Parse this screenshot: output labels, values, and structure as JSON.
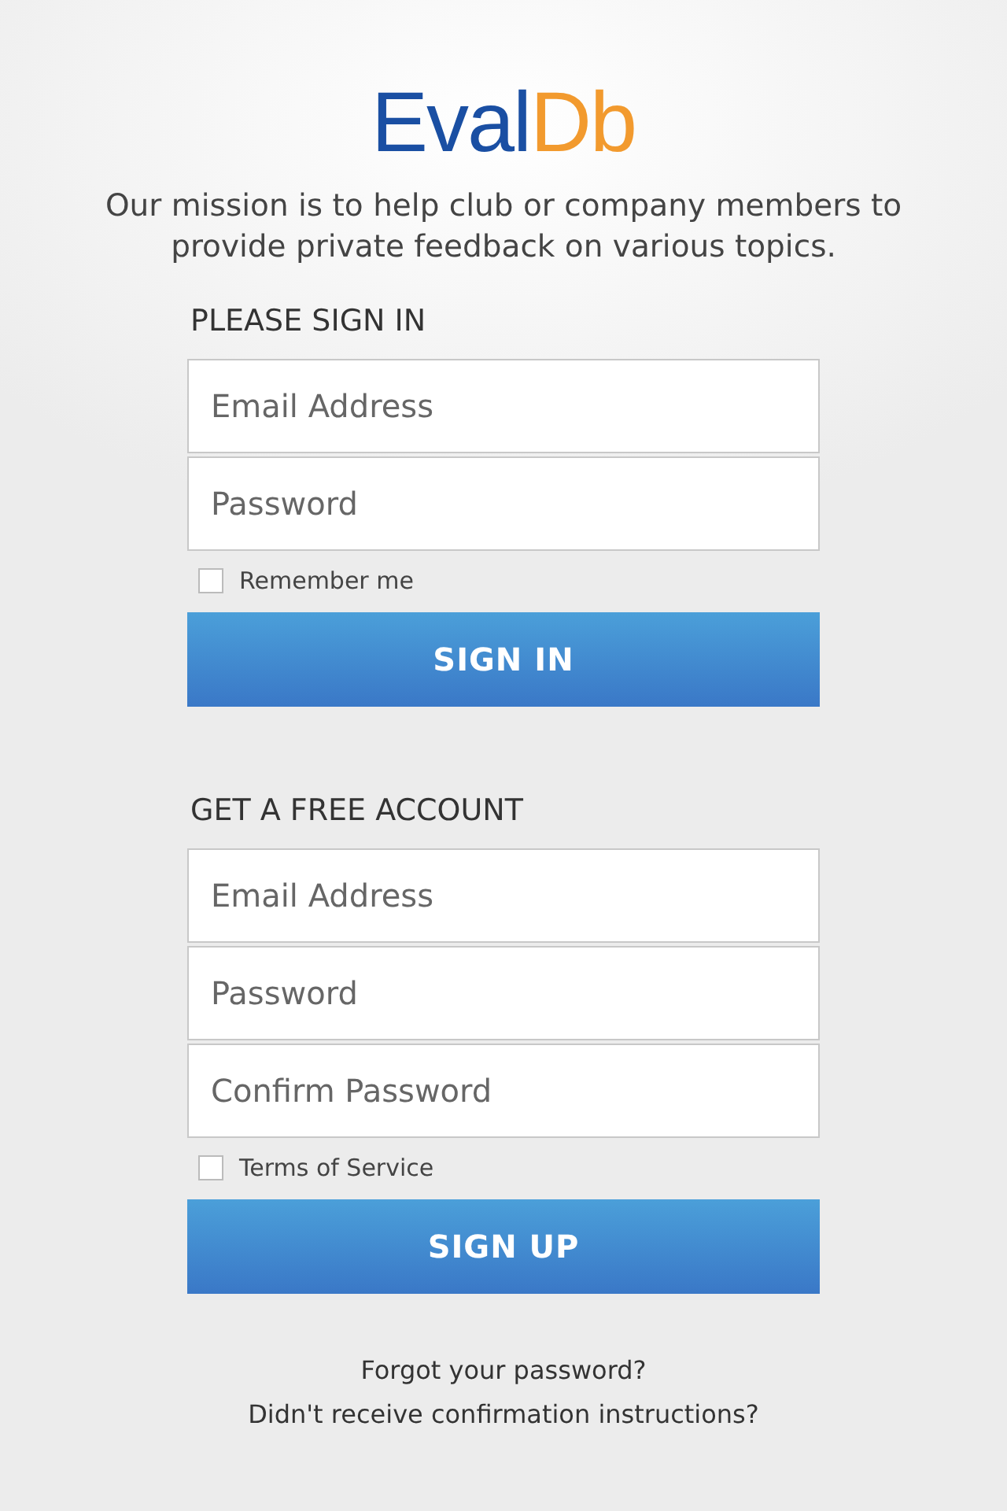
{
  "logo": {
    "parts": [
      {
        "text": "Eval",
        "color": "#1a4fa3"
      },
      {
        "text": "Db",
        "color": "#f29a2e"
      }
    ]
  },
  "mission": "Our mission is to help club or company members to provide private feedback on various topics.",
  "sections": [
    {
      "heading": "PLEASE SIGN IN",
      "fields": [
        {
          "placeholder": "Email Address"
        },
        {
          "placeholder": "Password"
        }
      ],
      "checkbox": {
        "label": "Remember me",
        "checked": false
      },
      "button": "SIGN IN"
    },
    {
      "heading": "GET A FREE ACCOUNT",
      "fields": [
        {
          "placeholder": "Email Address"
        },
        {
          "placeholder": "Password"
        },
        {
          "placeholder": "Confirm Password"
        }
      ],
      "checkbox": {
        "label": "Terms of Service",
        "checked": false
      },
      "button": "SIGN UP"
    }
  ],
  "links": [
    "Forgot your password?",
    "Didn't receive confirmation instructions?"
  ]
}
